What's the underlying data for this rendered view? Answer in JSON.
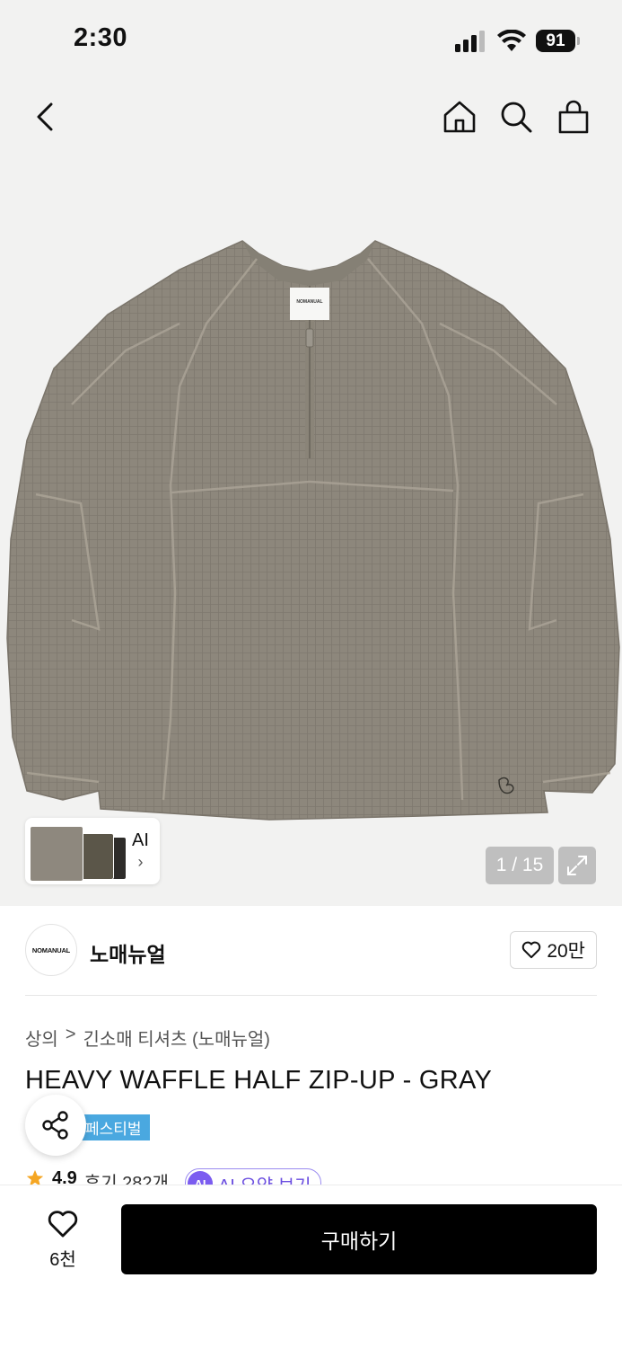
{
  "status_bar": {
    "time": "2:30",
    "battery": "91"
  },
  "product_image": {
    "tag_text": "NOMANUAL",
    "page_current": "1",
    "page_separator": "/",
    "page_total": "15",
    "thumbnail_label": "AI",
    "thumbnail_chevron": "›"
  },
  "brand": {
    "logo_text": "NOMANUAL",
    "name": "노매뉴얼",
    "likes": "20만"
  },
  "breadcrumb": {
    "category": "상의",
    "separator": ">",
    "subcategory": "긴소매 티셔츠 (노매뉴얼)"
  },
  "product": {
    "title": "HEAVY WAFFLE HALF ZIP-UP - GRAY",
    "badge": "페스티벌",
    "rating": "4.9",
    "reviews": "후기 282개",
    "ai_badge": "AI",
    "ai_summary": "AI 요약 보기"
  },
  "bottom_bar": {
    "wish_count": "6천",
    "buy_label": "구매하기"
  },
  "colors": {
    "accent": "#000000",
    "badge": "#4aa8e0",
    "ai": "#7b5cf0",
    "star": "#f5a623"
  },
  "icons": [
    "back-arrow-icon",
    "home-icon",
    "search-icon",
    "shopping-bag-icon",
    "expand-icon",
    "heart-icon",
    "share-icon",
    "star-icon"
  ]
}
